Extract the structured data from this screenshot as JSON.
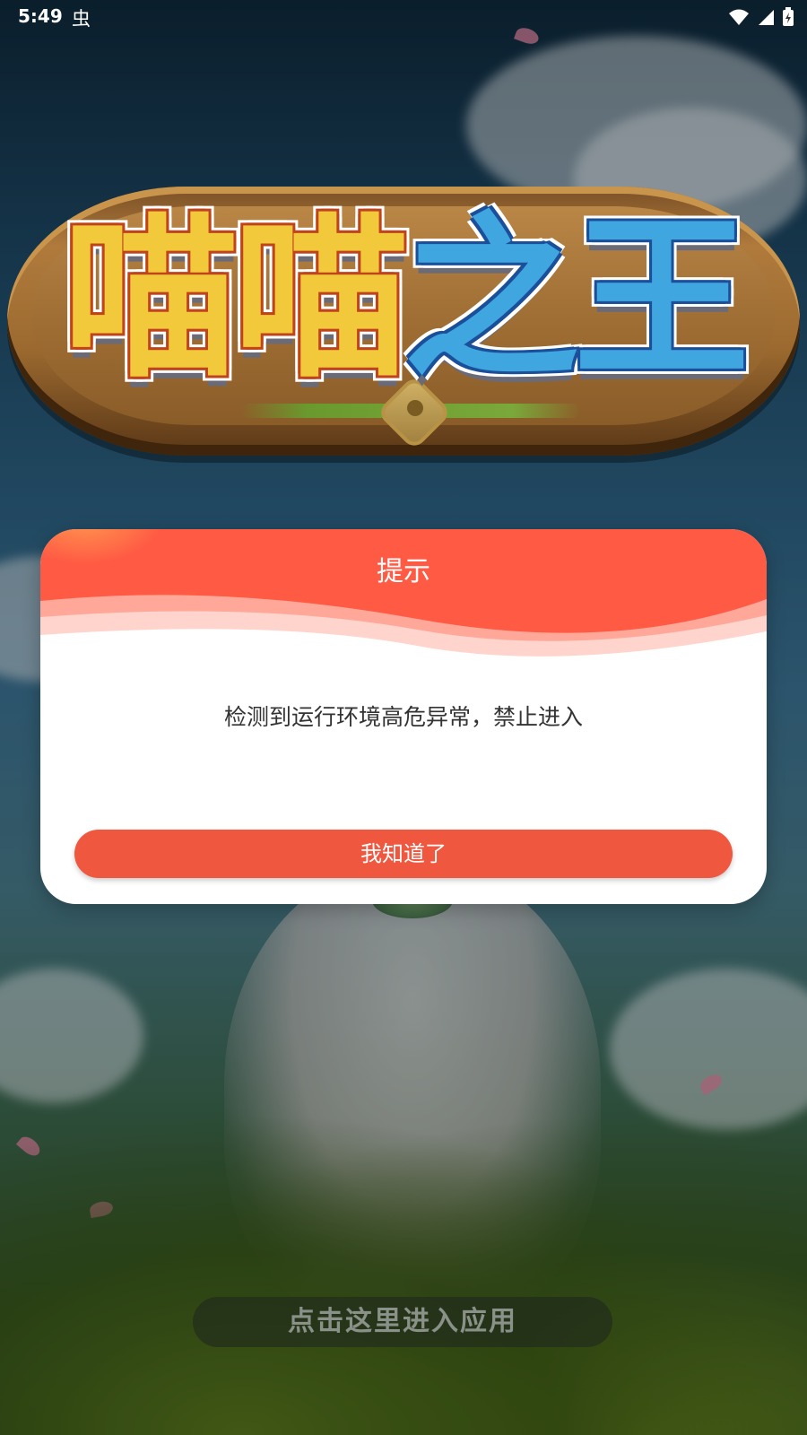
{
  "status_bar": {
    "time": "5:49",
    "notification_glyph": "虫",
    "icons": [
      "wifi-icon",
      "cellular-signal-icon",
      "battery-charging-icon"
    ]
  },
  "logo": {
    "text_warm": "喵喵",
    "text_cool": "之王",
    "colors": {
      "warm": "#f2c93a",
      "cool": "#3fa6df",
      "board": "#a06f35"
    }
  },
  "dialog": {
    "title": "提示",
    "message": "检测到运行环境高危异常，禁止进入",
    "confirm_label": "我知道了",
    "colors": {
      "header": "#ff5a44",
      "button": "#f0573f"
    }
  },
  "enter_button": {
    "label": "点击这里进入应用"
  }
}
